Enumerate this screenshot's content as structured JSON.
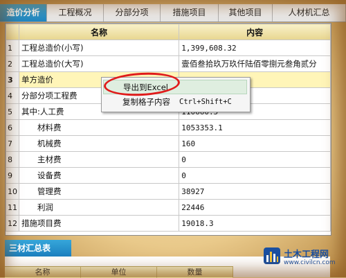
{
  "tabs": [
    "造价分析",
    "工程概况",
    "分部分项",
    "措施项目",
    "其他项目",
    "人材机汇总"
  ],
  "table": {
    "columns": [
      "名称",
      "内容"
    ],
    "rows": [
      {
        "num": "1",
        "name": "工程总造价(小写)",
        "value": "1,399,608.32"
      },
      {
        "num": "2",
        "name": "工程总造价(大写)",
        "value": "壹佰叁拾玖万玖仟陆佰零捌元叁角贰分"
      },
      {
        "num": "3",
        "name": "单方造价",
        "value": ""
      },
      {
        "num": "4",
        "name": "分部分项工程费",
        "value": ""
      },
      {
        "num": "5",
        "name": "其中:人工费",
        "value": "110660.5"
      },
      {
        "num": "6",
        "name": "材料费",
        "value": "1053353.1"
      },
      {
        "num": "7",
        "name": "机械费",
        "value": "160"
      },
      {
        "num": "8",
        "name": "主材费",
        "value": "0"
      },
      {
        "num": "9",
        "name": "设备费",
        "value": "0"
      },
      {
        "num": "10",
        "name": "管理费",
        "value": "38927"
      },
      {
        "num": "11",
        "name": "利润",
        "value": "22446"
      },
      {
        "num": "12",
        "name": "措施项目费",
        "value": "19018.3"
      }
    ]
  },
  "context_menu": {
    "export": "导出到Excel",
    "copy": "复制格子内容",
    "copy_shortcut": "Ctrl+Shift+C"
  },
  "bottom": {
    "title": "三材汇总表",
    "columns": [
      "名称",
      "单位",
      "数量"
    ]
  },
  "logo": {
    "name": "土木工程网",
    "url": "www.civilcn.com"
  },
  "colors": {
    "accent": "#1f86c2",
    "highlight_oval": "#e01b1b",
    "selected_row": "#fff5b8"
  }
}
